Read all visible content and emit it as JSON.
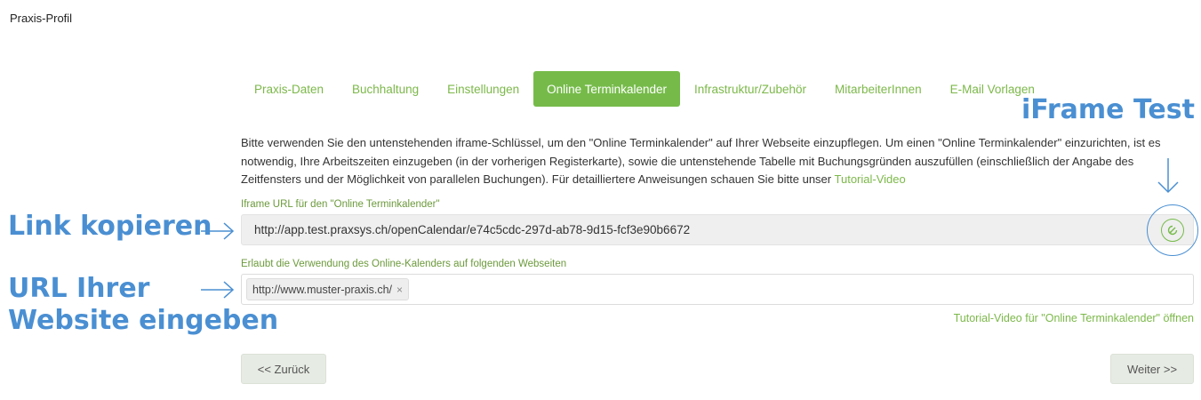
{
  "page": {
    "title": "Praxis-Profil"
  },
  "tabs": [
    {
      "label": "Praxis-Daten",
      "active": false
    },
    {
      "label": "Buchhaltung",
      "active": false
    },
    {
      "label": "Einstellungen",
      "active": false
    },
    {
      "label": "Online Terminkalender",
      "active": true
    },
    {
      "label": "Infrastruktur/Zubehör",
      "active": false
    },
    {
      "label": "MitarbeiterInnen",
      "active": false
    },
    {
      "label": "E-Mail Vorlagen",
      "active": false
    }
  ],
  "annotations": {
    "iframe_test": "iFrame Test",
    "link_copy": "Link kopieren",
    "url_line1": "URL Ihrer",
    "url_line2": "Website eingeben",
    "color": "#4a8fd2"
  },
  "description": {
    "text": "Bitte verwenden Sie den untenstehenden iframe-Schlüssel, um den \"Online Terminkalender\" auf Ihrer Webseite einzupflegen. Um einen \"Online Terminkalender\" einzurichten, ist es notwendig, Ihre Arbeitszeiten einzugeben (in der vorherigen Registerkarte), sowie die untenstehende Tabelle mit Buchungsgründen auszufüllen (einschließlich der Angabe des Zeitfensters und der Möglichkeit von parallelen Buchungen). Für detailliertere Anweisungen schauen Sie bitte unser",
    "link_text": "Tutorial-Video"
  },
  "iframe": {
    "label": "Iframe URL für den \"Online Terminkalender\"",
    "url": "http://app.test.praxsys.ch/openCalendar/e74c5cdc-297d-ab78-9d15-fcf3e90b6672",
    "copy_icon": "open-external-icon"
  },
  "allowed_sites": {
    "label": "Erlaubt die Verwendung des Online-Kalenders auf folgenden Webseiten",
    "tags": [
      "http://www.muster-praxis.ch/"
    ],
    "remove_symbol": "×"
  },
  "tutorial_link": "Tutorial-Video für \"Online Terminkalender\" öffnen",
  "buttons": {
    "back": "<< Zurück",
    "next": "Weiter >>"
  },
  "colors": {
    "accent_green": "#76bb4a",
    "link_green": "#7cb84a",
    "annotation_blue": "#4a8fd2"
  }
}
